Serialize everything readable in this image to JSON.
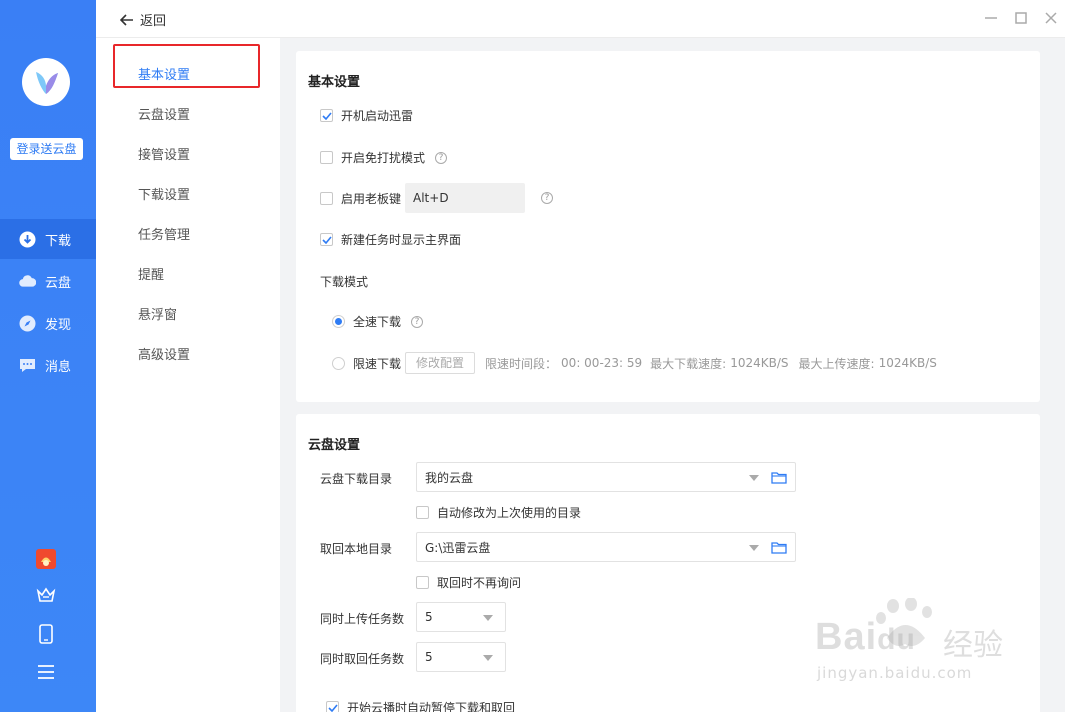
{
  "sidebar": {
    "login_label": "登录送云盘",
    "nav": [
      {
        "label": "下载",
        "icon": "download-icon"
      },
      {
        "label": "云盘",
        "icon": "cloud-icon"
      },
      {
        "label": "发现",
        "icon": "compass-icon"
      },
      {
        "label": "消息",
        "icon": "message-icon"
      }
    ],
    "accent": "#3a7ff5"
  },
  "topbar": {
    "back_label": "返回"
  },
  "menu": {
    "items": [
      "基本设置",
      "云盘设置",
      "接管设置",
      "下载设置",
      "任务管理",
      "提醒",
      "悬浮窗",
      "高级设置"
    ],
    "active": "基本设置"
  },
  "basic": {
    "title": "基本设置",
    "startup": {
      "label": "开机启动迅雷",
      "checked": true
    },
    "dnd": {
      "label": "开启免打扰模式",
      "checked": false
    },
    "boss_key": {
      "label": "启用老板键",
      "checked": false,
      "value": "Alt+D"
    },
    "show_main": {
      "label": "新建任务时显示主界面",
      "checked": true
    },
    "mode_title": "下载模式",
    "full_speed": "全速下载",
    "limit_speed": "限速下载",
    "modify_btn": "修改配置",
    "limit_period_label": "限速时间段：",
    "limit_period": "00: 00-23: 59",
    "max_down_label": "最大下载速度:",
    "max_down": "1024KB/S",
    "max_up_label": "最大上传速度:",
    "max_up": "1024KB/S"
  },
  "cloud": {
    "title": "云盘设置",
    "download_dir_label": "云盘下载目录",
    "download_dir": "我的云盘",
    "auto_modify": "自动修改为上次使用的目录",
    "local_dir_label": "取回本地目录",
    "local_dir": "G:\\迅雷云盘",
    "no_ask": "取回时不再询问",
    "upload_tasks_label": "同时上传任务数",
    "upload_tasks": "5",
    "retrieve_tasks_label": "同时取回任务数",
    "retrieve_tasks": "5",
    "pause_on_play": "开始云播时自动暂停下载和取回"
  },
  "watermark": {
    "brand": "Bai",
    "brand2": "du",
    "cn": "经验",
    "url": "jingyan.baidu.com"
  }
}
